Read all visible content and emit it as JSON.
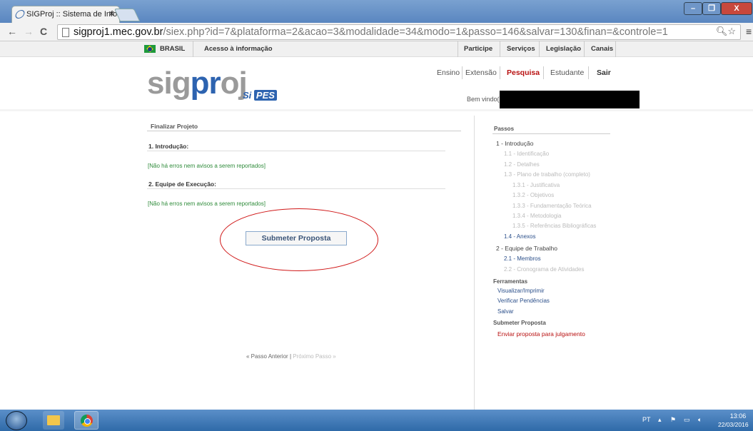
{
  "browser": {
    "tab_title": "SIGProj :: Sistema de Infor",
    "tab_close": "✕",
    "url_host": "sigproj1.mec.gov.br",
    "url_path": "/siex.php?id=7&plataforma=2&acao=3&modalidade=34&modo=1&passo=146&salvar=130&finan=&controle=1",
    "back": "←",
    "forward": "→",
    "reload": "C",
    "tools": "🔍︎☆",
    "menu": "≡",
    "win_min": "–",
    "win_restore": "❐",
    "win_close": "X"
  },
  "govbar": {
    "brasil": "BRASIL",
    "acesso": "Acesso à informação",
    "links": [
      "Participe",
      "Serviços",
      "Legislação",
      "Canais"
    ]
  },
  "header": {
    "logo_sig": "sig",
    "logo_pr": "pr",
    "logo_oj": "oj",
    "logo_si": "Si",
    "logo_pes": "PES",
    "nav": [
      "Ensino",
      "Extensão",
      "Pesquisa",
      "Estudante",
      "Sair"
    ],
    "welcome": "Bem vindo(a"
  },
  "main": {
    "title": "Finalizar Projeto",
    "sections": [
      {
        "heading": "1. Introdução:",
        "message": "[Não há erros nem avisos a serem reportados]"
      },
      {
        "heading": "2. Equipe de Execução:",
        "message": "[Não há erros nem avisos a serem reportados]"
      }
    ],
    "submit_label": "Submeter Proposta",
    "pager_prev": "« Passo Anterior",
    "pager_sep": "|",
    "pager_next": "Próximo Passo »"
  },
  "steps": {
    "title": "Passos",
    "items": [
      "1 - Introdução",
      "1.1 - Identificação",
      "1.2 - Detalhes",
      "1.3 - Plano de trabalho (completo)",
      "1.3.1 - Justificativa",
      "1.3.2 - Objetivos",
      "1.3.3 - Fundamentação Teórica",
      "1.3.4 - Metodologia",
      "1.3.5 - Referências Bibliográficas",
      "1.4 - Anexos",
      "2 - Equipe de Trabalho",
      "2.1 - Membros",
      "2.2 - Cronograma de Atividades"
    ],
    "tools_heading": "Ferramentas",
    "tools": [
      "Visualizar/Imprimir",
      "Verificar Pendências",
      "Salvar"
    ],
    "submit_heading": "Submeter Proposta",
    "submit_link": "Enviar proposta para julgamento"
  },
  "taskbar": {
    "lang": "PT",
    "time": "13:06",
    "date": "22/03/2016"
  }
}
